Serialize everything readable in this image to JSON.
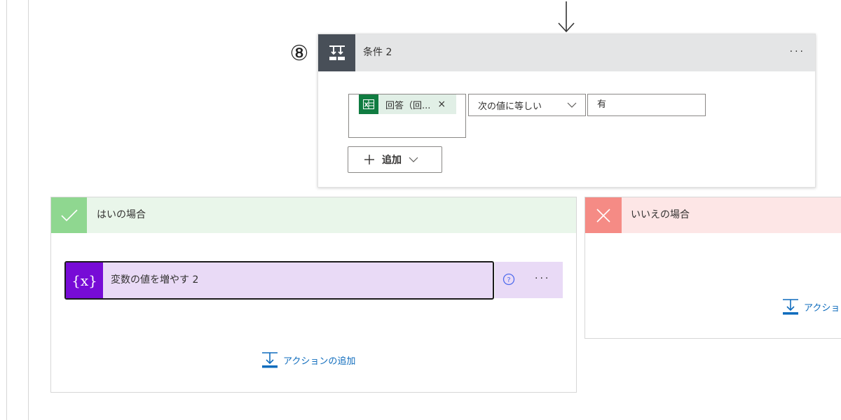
{
  "step_number": "⑧",
  "condition": {
    "title": "条件 2",
    "more_label": "···",
    "left_operand_token": "回答（回...",
    "token_remove": "×",
    "operator": "次の値に等しい",
    "right_operand": "有",
    "add_button_label": "追加"
  },
  "yes_branch": {
    "title": "はいの場合",
    "action": {
      "title": "変数の値を増やす 2",
      "icon_text": "{x}",
      "more_label": "···"
    },
    "add_action_label": "アクションの追加"
  },
  "no_branch": {
    "title": "いいえの場合",
    "add_action_label": "アクション"
  },
  "colors": {
    "condition_icon_bg": "#484f58",
    "yes_icon_bg": "#8fd790",
    "no_icon_bg": "#f58b85",
    "variable_icon_bg": "#770bd6",
    "excel_green": "#107c41",
    "link_blue": "#0f6cbd"
  }
}
